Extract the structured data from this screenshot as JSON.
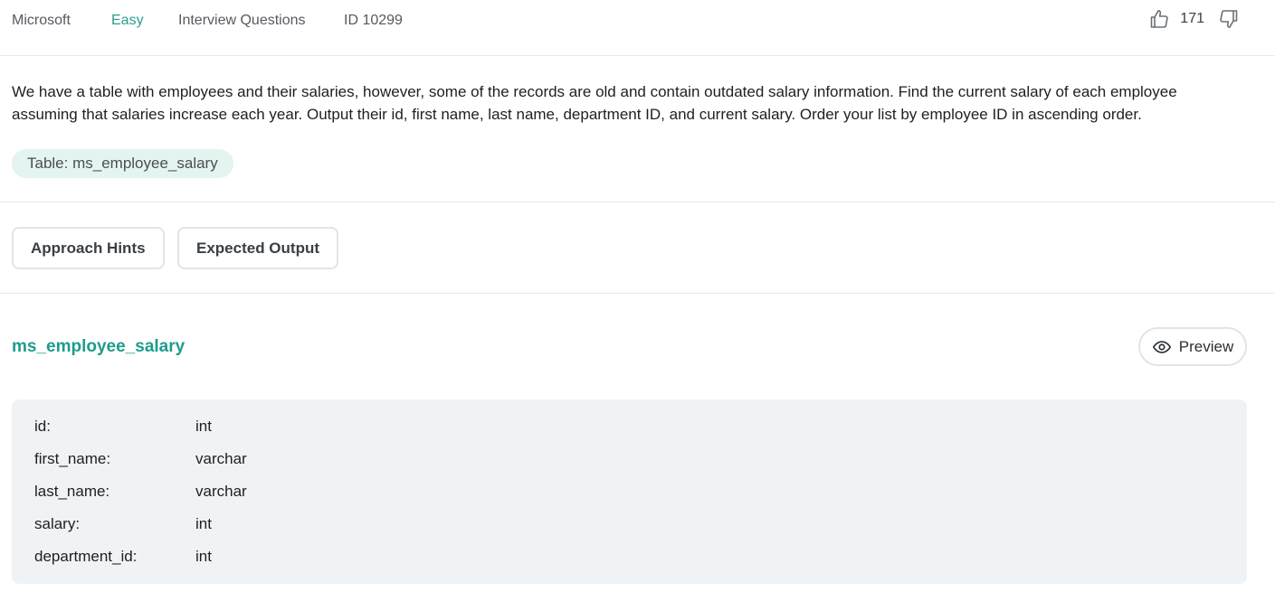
{
  "meta": {
    "company": "Microsoft",
    "difficulty": "Easy",
    "category": "Interview Questions",
    "question_id": "ID 10299",
    "vote_count": "171"
  },
  "question": {
    "text": "We have a table with employees and their salaries, however, some of the records are old and contain outdated salary information. Find the current salary of each employee assuming that salaries increase each year. Output their id, first name, last name, department ID, and current salary. Order your list by employee ID in ascending order.",
    "table_chip": "Table: ms_employee_salary"
  },
  "actions": {
    "hints_label": "Approach Hints",
    "expected_label": "Expected Output"
  },
  "schema": {
    "table_name": "ms_employee_salary",
    "preview_label": "Preview",
    "columns": [
      {
        "name": "id:",
        "type": "int"
      },
      {
        "name": "first_name:",
        "type": "varchar"
      },
      {
        "name": "last_name:",
        "type": "varchar"
      },
      {
        "name": "salary:",
        "type": "int"
      },
      {
        "name": "department_id:",
        "type": "int"
      }
    ]
  },
  "icons": {
    "upvote": "thumbs-up-icon",
    "downvote": "thumbs-down-icon",
    "preview": "eye-icon"
  },
  "colors": {
    "accent": "#1e9c8c",
    "difficulty": "#2a9d8f",
    "chip_bg": "#e3f4f1",
    "schema_bg": "#f0f3f6"
  }
}
